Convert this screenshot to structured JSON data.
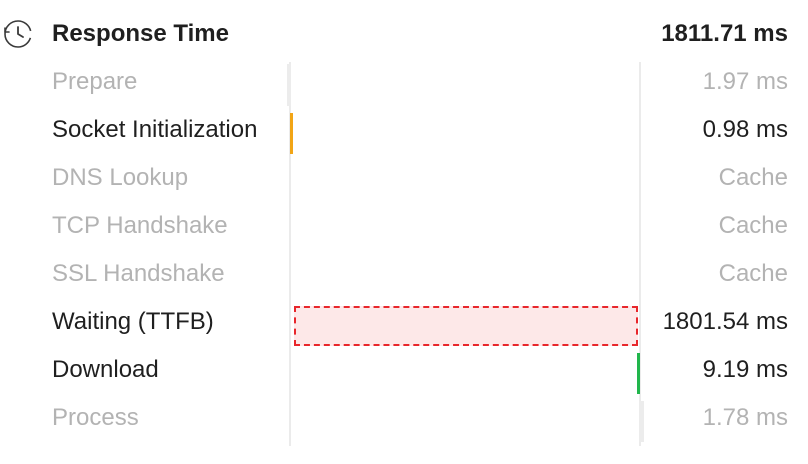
{
  "header": {
    "icon": "clock-icon",
    "title": "Response Time",
    "total": "1811.71 ms"
  },
  "phases": [
    {
      "label": "Prepare",
      "value": "1.97 ms",
      "state": "muted"
    },
    {
      "label": "Socket Initialization",
      "value": "0.98 ms",
      "state": "active",
      "color": "#f2a516"
    },
    {
      "label": "DNS Lookup",
      "value": "Cache",
      "state": "muted"
    },
    {
      "label": "TCP Handshake",
      "value": "Cache",
      "state": "muted"
    },
    {
      "label": "SSL Handshake",
      "value": "Cache",
      "state": "muted"
    },
    {
      "label": "Waiting (TTFB)",
      "value": "1801.54 ms",
      "state": "active",
      "color": "#e8262b"
    },
    {
      "label": "Download",
      "value": "9.19 ms",
      "state": "active",
      "color": "#21b64c"
    },
    {
      "label": "Process",
      "value": "1.78 ms",
      "state": "muted"
    }
  ],
  "colors": {
    "text_active": "#1f1f1f",
    "text_muted": "#b3b3b3",
    "socket": "#f2a516",
    "ttfb_border": "#e8262b",
    "ttfb_fill": "#fde8e8",
    "download": "#21b64c"
  }
}
